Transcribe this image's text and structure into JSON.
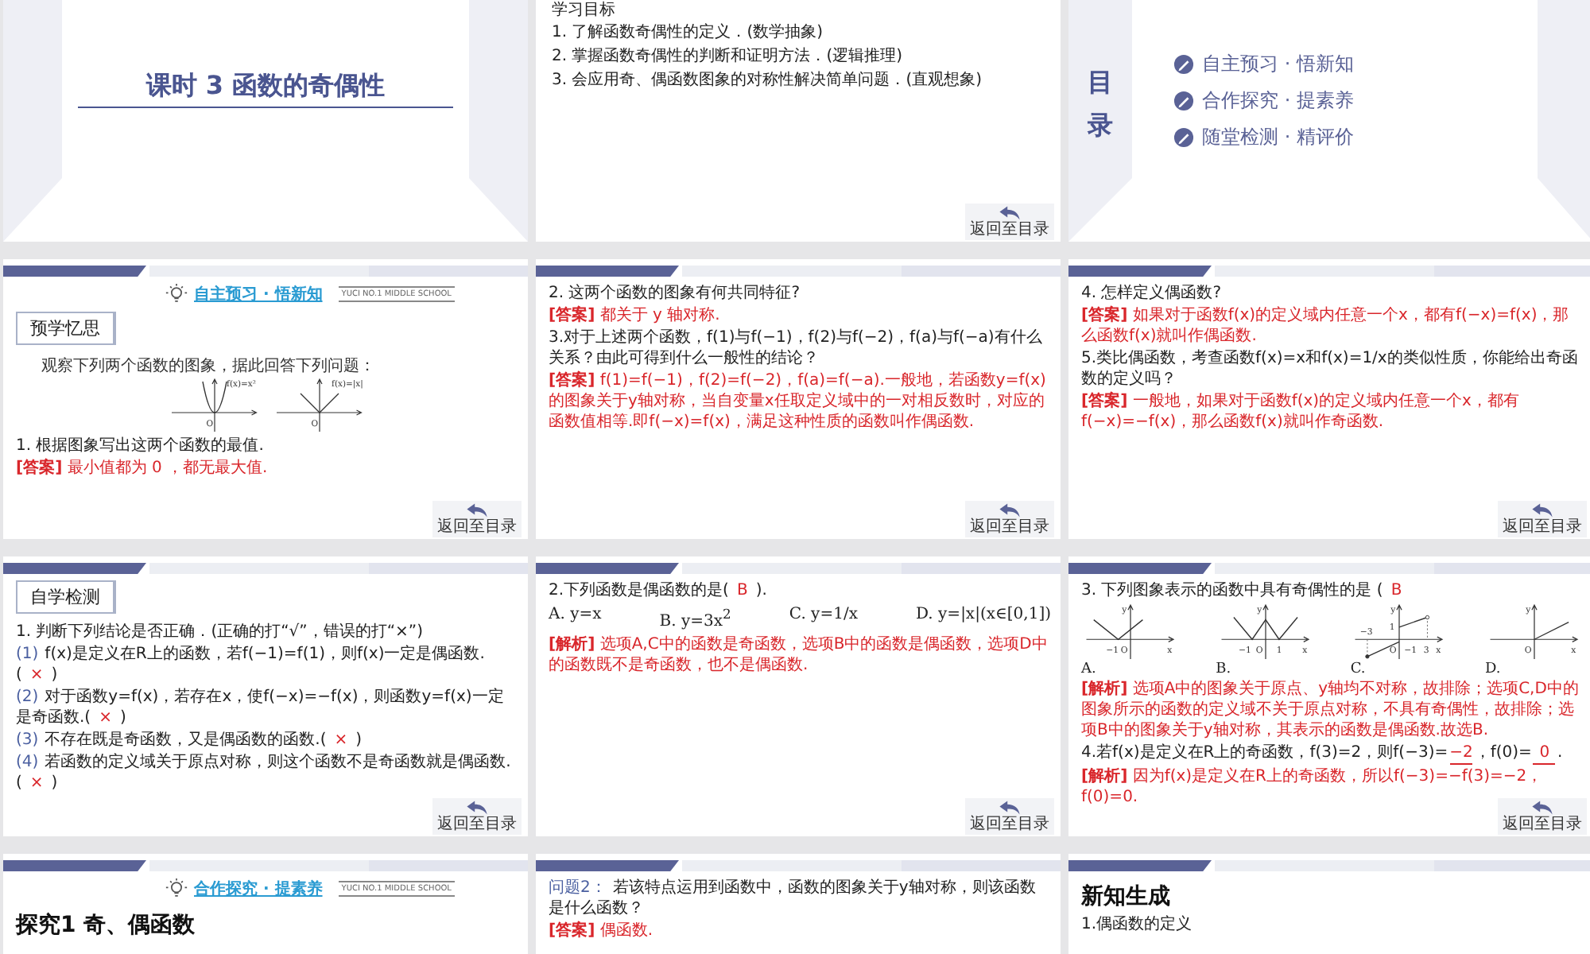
{
  "slides": [
    {
      "kind": "title",
      "title": "课时 3   函数的奇偶性"
    },
    {
      "kind": "objectives",
      "heading": "学习目标",
      "items": [
        "1. 了解函数奇偶性的定义．(数学抽象)",
        "2. 掌握函数奇偶性的判断和证明方法．(逻辑推理)",
        "3. 会应用奇、偶函数图象的对称性解决简单问题．(直观想象)"
      ],
      "back": "返回至目录"
    },
    {
      "kind": "toc",
      "heading": "目录",
      "items": [
        "自主预习 · 悟新知",
        "合作探究 · 提素养",
        "随堂检测 · 精评价"
      ]
    },
    {
      "kind": "content",
      "banner": {
        "title": "自主预习 · 悟新知",
        "school": "YUCI NO.1 MIDDLE SCHOOL"
      },
      "tag": "预学忆思",
      "back": "返回至目录",
      "blocks": [
        {
          "kind": "intro",
          "text": "观察下列两个函数的图象，据此回答下列问题："
        },
        {
          "kind": "graphs",
          "items": [
            {
              "kind": "parabola",
              "labels": [
                "f(x)=x²",
                "O"
              ]
            },
            {
              "kind": "vee",
              "labels": [
                "f(x)=|x|",
                "O"
              ]
            }
          ]
        },
        {
          "kind": "q",
          "text": "1. 根据图象写出这两个函数的最值."
        },
        {
          "kind": "ans",
          "text": "**[答案]** 最小值都为 0 ，都无最大值."
        }
      ]
    },
    {
      "kind": "content",
      "back": "返回至目录",
      "blocks": [
        {
          "kind": "q",
          "text": "2. 这两个函数的图象有何共同特征?"
        },
        {
          "kind": "ans",
          "text": "**[答案]** 都关于 y 轴对称."
        },
        {
          "kind": "q",
          "text": "3.对于上述两个函数，f(1)与f(−1)，f(2)与f(−2)，f(a)与f(−a)有什么关系？由此可得到什么一般性的结论？"
        },
        {
          "kind": "ans",
          "text": "**[答案]** f(1)=f(−1)，f(2)=f(−2)，f(a)=f(−a).一般地，若函数y=f(x)的图象关于y轴对称，当自变量x任取定义域中的一对相反数时，对应的函数值相等.即f(−x)=f(x)，满足这种性质的函数叫作偶函数."
        }
      ]
    },
    {
      "kind": "content",
      "back": "返回至目录",
      "blocks": [
        {
          "kind": "q",
          "text": "4. 怎样定义偶函数?"
        },
        {
          "kind": "ans",
          "text": "**[答案]** 如果对于函数f(x)的定义域内任意一个x，都有f(−x)=f(x)，那么函数f(x)就叫作偶函数."
        },
        {
          "kind": "q",
          "text": "5.类比偶函数，考查函数f(x)=x和f(x)=1/x的类似性质，你能给出奇函数的定义吗？"
        },
        {
          "kind": "ans",
          "text": "**[答案]** 一般地，如果对于函数f(x)的定义域内任意一个x，都有f(−x)=−f(x)，那么函数f(x)就叫作奇函数."
        }
      ]
    },
    {
      "kind": "content",
      "tag": "自学检测",
      "back": "返回至目录",
      "blocks": [
        {
          "kind": "q",
          "text": "1. 判断下列结论是否正确．(正确的打“√”，错误的打“×”)"
        },
        {
          "kind": "parts",
          "parts": [
            {
              "kind": "num",
              "text": "(1)"
            },
            {
              "kind": "text",
              "text": "f(x)是定义在R上的函数，若f(−1)=f(1)，则f(x)一定是偶函数.("
            },
            {
              "kind": "answer",
              "text": "×"
            },
            {
              "kind": "text",
              "text": ")"
            }
          ]
        },
        {
          "kind": "parts",
          "parts": [
            {
              "kind": "num",
              "text": "(2)"
            },
            {
              "kind": "text",
              "text": "对于函数y=f(x)，若存在x，使f(−x)=−f(x)，则函数y=f(x)一定是奇函数.("
            },
            {
              "kind": "answer",
              "text": "×"
            },
            {
              "kind": "text",
              "text": ")"
            }
          ]
        },
        {
          "kind": "parts",
          "parts": [
            {
              "kind": "num",
              "text": "(3)"
            },
            {
              "kind": "text",
              "text": "不存在既是奇函数，又是偶函数的函数.("
            },
            {
              "kind": "answer",
              "text": "×"
            },
            {
              "kind": "text",
              "text": ")"
            }
          ]
        },
        {
          "kind": "parts",
          "parts": [
            {
              "kind": "num",
              "text": "(4)"
            },
            {
              "kind": "text",
              "text": "若函数的定义域关于原点对称，则这个函数不是奇函数就是偶函数.("
            },
            {
              "kind": "answer",
              "text": "×"
            },
            {
              "kind": "text",
              "text": ")"
            }
          ]
        }
      ]
    },
    {
      "kind": "content",
      "back": "返回至目录",
      "blocks": [
        {
          "kind": "parts",
          "parts": [
            {
              "kind": "text",
              "text": "2.下列函数是偶函数的是("
            },
            {
              "kind": "answer",
              "text": "B"
            },
            {
              "kind": "text",
              "text": ")."
            }
          ]
        },
        {
          "kind": "options",
          "items": [
            "A. y=x",
            "B. y=3x$^{2}$",
            "C. y=1/x",
            "D. y=|x|(x∈[0,1])"
          ]
        },
        {
          "kind": "ans",
          "text": "**[解析]** 选项A,C中的函数是奇函数，选项B中的函数是偶函数，选项D中的函数既不是奇函数，也不是偶函数."
        }
      ]
    },
    {
      "kind": "content",
      "back": "返回至目录",
      "blocks": [
        {
          "kind": "parts",
          "parts": [
            {
              "kind": "text",
              "text": "3. 下列图象表示的函数中具有奇偶性的是 ("
            },
            {
              "kind": "answer",
              "text": "B"
            }
          ]
        },
        {
          "kind": "graphs",
          "items": [
            {
              "kind": "a",
              "letter": "A.",
              "labels": [
                "y",
                "−1",
                "O",
                "x"
              ]
            },
            {
              "kind": "b",
              "letter": "B.",
              "labels": [
                "y",
                "−1",
                "O",
                "1",
                "x"
              ]
            },
            {
              "kind": "c",
              "letter": "C.",
              "labels": [
                "y",
                "1",
                "−3",
                "O",
                "−1",
                "3",
                "x"
              ]
            },
            {
              "kind": "d",
              "letter": "D.",
              "labels": [
                "y",
                "O",
                "x"
              ]
            }
          ]
        },
        {
          "kind": "ans",
          "text": "**[解析]** 选项A中的图象关于原点、y轴均不对称，故排除；选项C,D中的图象所示的函数的定义域不关于原点对称，不具有奇偶性，故排除；选项B中的图象关于y轴对称，其表示的函数是偶函数.故选B."
        },
        {
          "kind": "parts",
          "parts": [
            {
              "kind": "text",
              "text": "4.若f(x)是定义在R上的奇函数，f(3)=2，则f(−3)="
            },
            {
              "kind": "blank",
              "text": "−2"
            },
            {
              "kind": "text",
              "text": "，f(0)="
            },
            {
              "kind": "blank",
              "text": "0"
            },
            {
              "kind": "text",
              "text": "."
            }
          ]
        },
        {
          "kind": "ans",
          "text": "**[解析]** 因为f(x)是定义在R上的奇函数，所以f(−3)=−f(3)=−2，f(0)=0."
        }
      ]
    },
    {
      "kind": "content",
      "banner": {
        "title": "合作探究 · 提素养",
        "school": "YUCI NO.1 MIDDLE SCHOOL"
      },
      "blocks": [
        {
          "kind": "heading",
          "text": "探究1  奇、偶函数"
        }
      ]
    },
    {
      "kind": "content",
      "blocks": [
        {
          "kind": "parts",
          "parts": [
            {
              "kind": "num",
              "text": "问题2："
            },
            {
              "kind": "text",
              "text": "若该特点运用到函数中，函数的图象关于y轴对称，则该函数是什么函数？"
            }
          ]
        },
        {
          "kind": "ans",
          "text": "**[答案]** 偶函数."
        }
      ]
    },
    {
      "kind": "content",
      "blocks": [
        {
          "kind": "heading",
          "text": "新知生成"
        },
        {
          "kind": "q",
          "text": "1.偶函数的定义"
        }
      ]
    }
  ]
}
